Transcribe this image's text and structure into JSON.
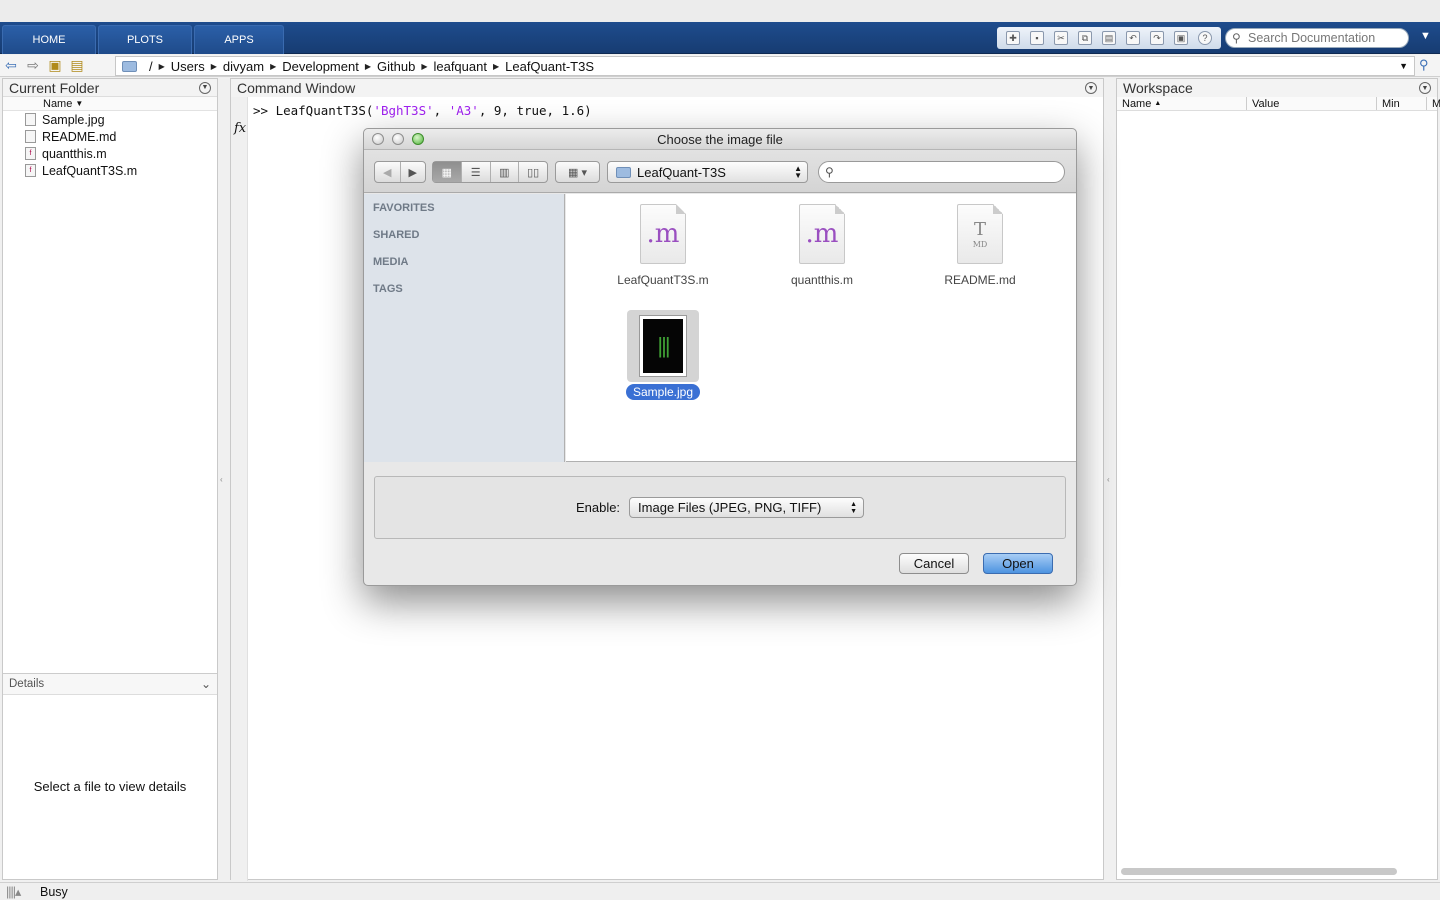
{
  "ribbon": {
    "tabs": [
      "HOME",
      "PLOTS",
      "APPS"
    ],
    "search_placeholder": "Search Documentation"
  },
  "address": {
    "path": [
      "/",
      "Users",
      "divyam",
      "Development",
      "Github",
      "leafquant",
      "LeafQuant-T3S"
    ]
  },
  "current_folder": {
    "title": "Current Folder",
    "column": "Name",
    "files": [
      "Sample.jpg",
      "README.md",
      "quantthis.m",
      "LeafQuantT3S.m"
    ],
    "details_title": "Details",
    "details_text": "Select a file to view details"
  },
  "command_window": {
    "title": "Command Window",
    "prompt": ">> ",
    "fn": "LeafQuantT3S(",
    "arg1": "'BghT3S'",
    "sep1": ", ",
    "arg2": "'A3'",
    "rest": ", 9, true, 1.6)",
    "fx": "fx"
  },
  "workspace": {
    "title": "Workspace",
    "columns": [
      "Name",
      "Value",
      "Min",
      "M"
    ]
  },
  "status": {
    "text": "Busy"
  },
  "dialog": {
    "title": "Choose the image file",
    "location": "LeafQuant-T3S",
    "sidebar": [
      "FAVORITES",
      "SHARED",
      "MEDIA",
      "TAGS"
    ],
    "files": [
      {
        "name": "LeafQuantT3S.m",
        "glyph": ".m"
      },
      {
        "name": "quantthis.m",
        "glyph": ".m"
      },
      {
        "name": "README.md",
        "glyph": "T",
        "sub": "MD"
      },
      {
        "name": "Sample.jpg",
        "selected": true
      }
    ],
    "enable_label": "Enable:",
    "enable_value": "Image Files (JPEG, PNG, TIFF)",
    "cancel": "Cancel",
    "open": "Open"
  },
  "colors": {
    "ribbon": "#1e4c8d",
    "selection": "#3a70d4",
    "string_literal": "#a020f0"
  }
}
